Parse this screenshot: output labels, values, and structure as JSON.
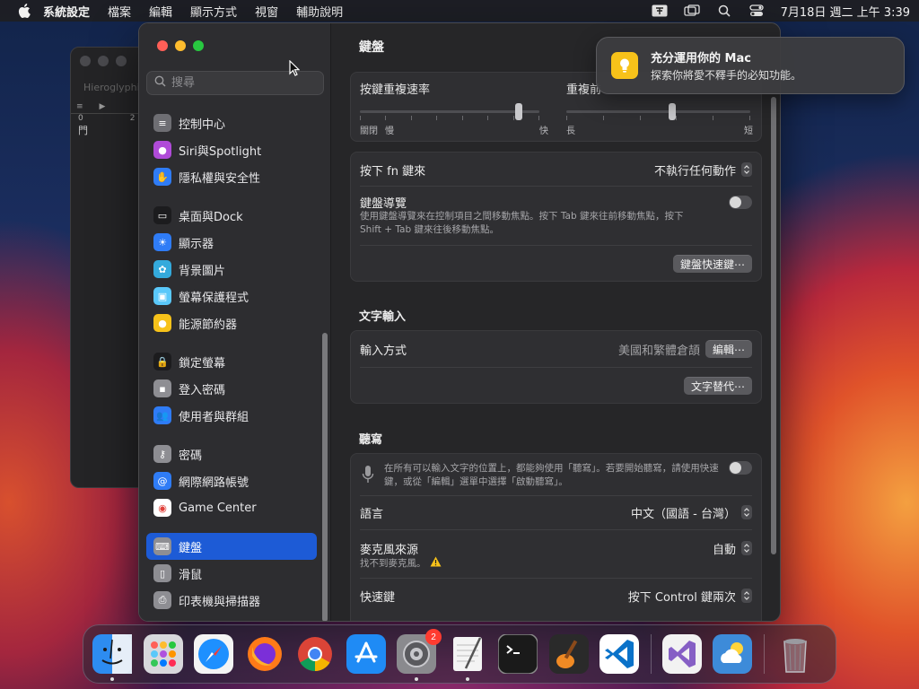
{
  "menubar": {
    "app_name": "系統設定",
    "items": [
      "檔案",
      "編輯",
      "顯示方式",
      "視窗",
      "輔助說明"
    ],
    "clock": "7月18日 週二 上午 3:39"
  },
  "background_window": {
    "title": "Hieroglyphica",
    "ruler": [
      "0",
      "2"
    ],
    "char": "門"
  },
  "sidebar": {
    "search_placeholder": "搜尋",
    "items": [
      {
        "label": "控制中心",
        "icon": "control-center-icon",
        "color": "#6e6e73"
      },
      {
        "label": "Siri與Spotlight",
        "icon": "siri-icon",
        "color": "#b04bd8"
      },
      {
        "label": "隱私權與安全性",
        "icon": "hand-icon",
        "color": "#2f7cf6"
      },
      {
        "label": "桌面與Dock",
        "icon": "dock-icon",
        "color": "#1c1c1e"
      },
      {
        "label": "顯示器",
        "icon": "sun-icon",
        "color": "#2f7cf6"
      },
      {
        "label": "背景圖片",
        "icon": "flower-icon",
        "color": "#34aadc"
      },
      {
        "label": "螢幕保護程式",
        "icon": "screensaver-icon",
        "color": "#5ac8fa"
      },
      {
        "label": "能源節約器",
        "icon": "bulb-icon",
        "color": "#f7c21a"
      },
      {
        "label": "鎖定螢幕",
        "icon": "lock-icon",
        "color": "#1c1c1e"
      },
      {
        "label": "登入密碼",
        "icon": "password-icon",
        "color": "#8e8e93"
      },
      {
        "label": "使用者與群組",
        "icon": "users-icon",
        "color": "#2f7cf6"
      },
      {
        "label": "密碼",
        "icon": "key-icon",
        "color": "#8e8e93"
      },
      {
        "label": "網際網路帳號",
        "icon": "at-icon",
        "color": "#2f7cf6"
      },
      {
        "label": "Game Center",
        "icon": "game-center-icon",
        "color": "#ffffff"
      },
      {
        "label": "鍵盤",
        "icon": "keyboard-icon",
        "color": "#8e8e93"
      },
      {
        "label": "滑鼠",
        "icon": "mouse-icon",
        "color": "#8e8e93"
      },
      {
        "label": "印表機與掃描器",
        "icon": "printer-icon",
        "color": "#8e8e93"
      }
    ],
    "selected_index": 14
  },
  "main": {
    "title": "鍵盤",
    "key_repeat": {
      "label": "按鍵重複速率",
      "left_labels": [
        "關閉",
        "慢"
      ],
      "right_label": "快",
      "value_fraction": 0.9,
      "tick_count": 8
    },
    "delay": {
      "label": "重複前",
      "left_label": "長",
      "right_label": "短",
      "value_fraction": 0.58,
      "tick_count": 6
    },
    "fn_key": {
      "label": "按下 fn 鍵來",
      "value": "不執行任何動作"
    },
    "keyboard_nav": {
      "label": "鍵盤導覽",
      "desc_line1": "使用鍵盤導覽來在控制項目之間移動焦點。按下 Tab 鍵來往前移動焦點，按下",
      "desc_line2": "Shift + Tab 鍵來往後移動焦點。",
      "enabled": false
    },
    "shortcuts_button": "鍵盤快速鍵⋯",
    "text_input": {
      "section": "文字輸入",
      "input_label": "輸入方式",
      "input_value": "美國和繁體倉頡",
      "edit_button": "編輯⋯",
      "replace_button": "文字替代⋯"
    },
    "dictation": {
      "section": "聽寫",
      "desc_line1": "在所有可以輸入文字的位置上，都能夠使用「聽寫」。若要開始聽寫，請使用快速",
      "desc_line2": "鍵，或從「編輯」選單中選擇「啟動聽寫」。",
      "enabled": false,
      "language_label": "語言",
      "language_value": "中文（國語 - 台灣）",
      "mic_label": "麥克風來源",
      "mic_value": "自動",
      "mic_warning": "找不到麥克風。",
      "shortcut_label": "快速鍵",
      "shortcut_value": "按下 Control 鍵兩次"
    }
  },
  "notification": {
    "title": "充分運用你的 Mac",
    "body": "探索你將愛不釋手的必知功能。"
  },
  "dock": {
    "apps": [
      {
        "name": "finder-icon",
        "color": "#2d8cf0",
        "running": true
      },
      {
        "name": "launchpad-icon",
        "color": "#d8d8dc",
        "running": false
      },
      {
        "name": "safari-icon",
        "color": "#1e90ff",
        "running": false
      },
      {
        "name": "firefox-icon",
        "color": "#ff7a18",
        "running": false
      },
      {
        "name": "chrome-icon",
        "color": "#ffffff",
        "running": false
      },
      {
        "name": "app-store-icon",
        "color": "#1f8bf5",
        "running": false
      },
      {
        "name": "system-settings-icon",
        "color": "#8a8a8e",
        "running": true,
        "badge": "2"
      },
      {
        "name": "textedit-icon",
        "color": "#f4f4f4",
        "running": true
      },
      {
        "name": "terminal-icon",
        "color": "#1a1a1a",
        "running": false
      },
      {
        "name": "garageband-icon",
        "color": "#2a2a2a",
        "running": false
      },
      {
        "name": "vscode-icon",
        "color": "#ffffff",
        "running": false
      },
      {
        "name": "visual-studio-icon",
        "color": "#f2f2f2",
        "running": false
      },
      {
        "name": "weather-icon",
        "color": "#3d8bd9",
        "running": false
      },
      {
        "name": "trash-icon",
        "color": "transparent",
        "running": false
      }
    ]
  }
}
